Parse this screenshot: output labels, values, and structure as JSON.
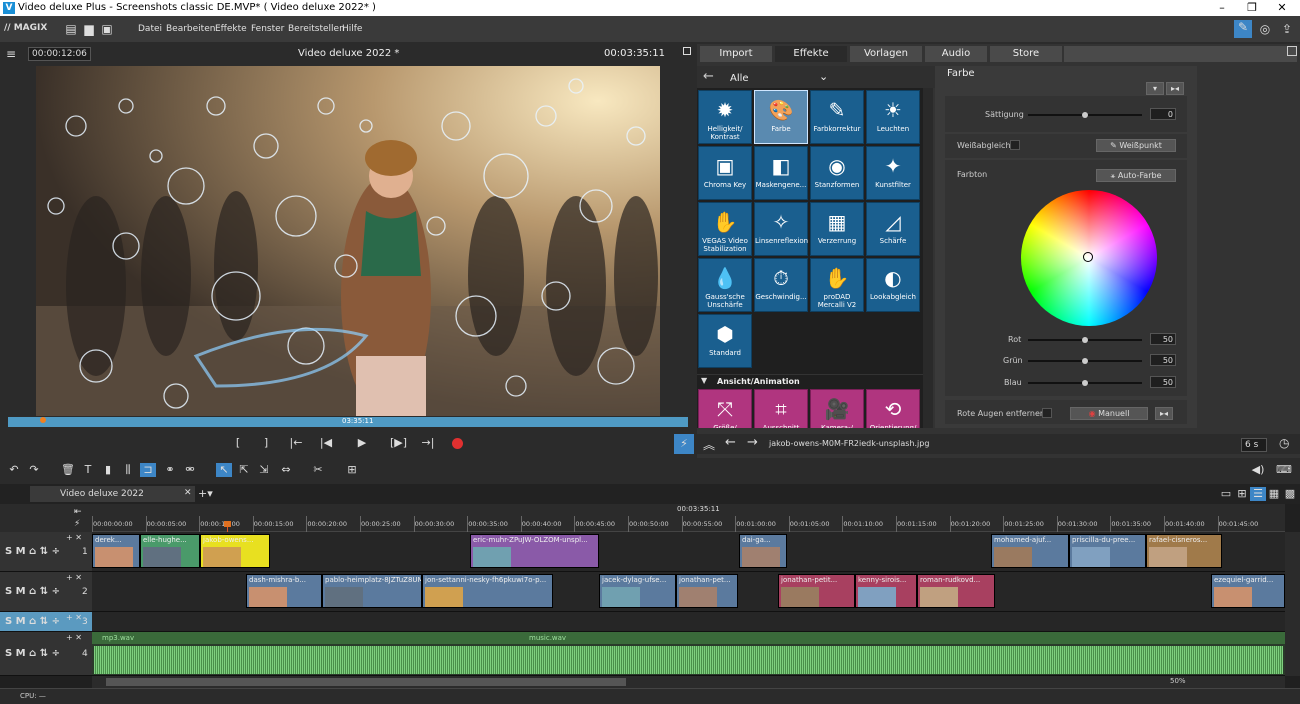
{
  "window": {
    "title": "Video deluxe Plus - Screenshots classic DE.MVP* ( Video deluxe 2022* )",
    "icon_letter": "V"
  },
  "menubar": {
    "brand": "// MAGIX",
    "items": [
      "Datei",
      "Bearbeiten",
      "Effekte",
      "Fenster",
      "Bereitstellen",
      "Hilfe"
    ]
  },
  "preview": {
    "timecode_left": "00:00:12:06",
    "title": "Video deluxe 2022 *",
    "timecode_right": "00:03:35:11",
    "scrub_time": "03:35:11"
  },
  "tabs": [
    "Import",
    "Effekte",
    "Vorlagen",
    "Audio",
    "Store"
  ],
  "active_tab": "Effekte",
  "effects": {
    "filter": "Alle",
    "items": [
      {
        "label": "Helligkeit/ Kontrast",
        "icon": "sun-icon"
      },
      {
        "label": "Farbe",
        "icon": "palette-icon"
      },
      {
        "label": "Farbkorrektur",
        "icon": "palette-brush-icon"
      },
      {
        "label": "Leuchten",
        "icon": "glow-icon"
      },
      {
        "label": "Chroma Key",
        "icon": "chroma-icon"
      },
      {
        "label": "Maskengene...",
        "icon": "mask-icon"
      },
      {
        "label": "Stanzformen",
        "icon": "shape-icon"
      },
      {
        "label": "Kunstfilter",
        "icon": "art-icon"
      },
      {
        "label": "VEGAS Video Stabilization",
        "icon": "hand-icon"
      },
      {
        "label": "Linsenreflexion",
        "icon": "lens-icon"
      },
      {
        "label": "Verzerrung",
        "icon": "distort-icon"
      },
      {
        "label": "Schärfe",
        "icon": "sharp-icon"
      },
      {
        "label": "Gauss'sche Unschärfe",
        "icon": "drop-icon"
      },
      {
        "label": "Geschwindig...",
        "icon": "speed-icon"
      },
      {
        "label": "proDAD Mercalli V2",
        "icon": "hand-icon"
      },
      {
        "label": "Lookabgleich",
        "icon": "look-icon"
      },
      {
        "label": "Standard",
        "icon": "hexagon-icon"
      }
    ],
    "section2": "Ansicht/Animation",
    "items2": [
      {
        "label": "Größe/",
        "icon": "resize-icon"
      },
      {
        "label": "Ausschnitt",
        "icon": "crop-icon"
      },
      {
        "label": "Kamera-/",
        "icon": "camera-icon"
      },
      {
        "label": "Orientierung/",
        "icon": "rotate-icon"
      }
    ]
  },
  "color_panel": {
    "title": "Farbe",
    "saturation_label": "Sättigung",
    "saturation_value": "0",
    "saturation_level": 0.5,
    "wb_label": "Weißabgleich",
    "wb_button": "Weißpunkt",
    "hue_label": "Farbton",
    "auto_button": "Auto-Farbe",
    "rgb": [
      {
        "label": "Rot",
        "value": "50",
        "level": 0.5
      },
      {
        "label": "Grün",
        "value": "50",
        "level": 0.5
      },
      {
        "label": "Blau",
        "value": "50",
        "level": 0.5
      }
    ],
    "redeye_label": "Rote Augen entfernen",
    "redeye_button": "Manuell"
  },
  "navbar": {
    "file": "jakob-owens-M0M-FR2iedk-unsplash.jpg",
    "duration": "6 s"
  },
  "timeline": {
    "tab": "Video deluxe 2022",
    "position": "00:03:35:11",
    "ruler": [
      "00:00:00:00",
      "00:00:05:00",
      "00:00:10:00",
      "00:00:15:00",
      "00:00:20:00",
      "00:00:25:00",
      "00:00:30:00",
      "00:00:35:00",
      "00:00:40:00",
      "00:00:45:00",
      "00:00:50:00",
      "00:00:55:00",
      "00:01:00:00",
      "00:01:05:00",
      "00:01:10:00",
      "00:01:15:00",
      "00:01:20:00",
      "00:01:25:00",
      "00:01:30:00",
      "00:01:35:00",
      "00:01:40:00",
      "00:01:45:00"
    ],
    "tracks": [
      {
        "num": "1",
        "clips": [
          {
            "label": "derek...",
            "start": 0,
            "end": 48,
            "color": "#5b7a9e"
          },
          {
            "label": "elle-hughe...",
            "start": 48,
            "end": 108,
            "color": "#4a9a6a"
          },
          {
            "label": "jakob-owens...",
            "start": 108,
            "end": 178,
            "color": "#e8e020"
          },
          {
            "label": "eric-muhr-ZPuJW-OLZOM-unspl...",
            "start": 378,
            "end": 507,
            "color": "#8a5aa8"
          },
          {
            "label": "dai-ga...",
            "start": 647,
            "end": 695,
            "color": "#5b7a9e"
          },
          {
            "label": "mohamed-ajuf...",
            "start": 899,
            "end": 977,
            "color": "#5b7a9e"
          },
          {
            "label": "priscilla-du-pree...",
            "start": 977,
            "end": 1054,
            "color": "#5b7a9e"
          },
          {
            "label": "rafael-cisneros...",
            "start": 1054,
            "end": 1130,
            "color": "#a07a4a"
          }
        ]
      },
      {
        "num": "2",
        "clips": [
          {
            "label": "dash-mishra-b...",
            "start": 154,
            "end": 230,
            "color": "#5b7a9e"
          },
          {
            "label": "pablo-heimplatz-8JZTuZ8UM...",
            "start": 230,
            "end": 330,
            "color": "#5b7a9e"
          },
          {
            "label": "jon-settanni-nesky-fh6pkuwi7o-p...",
            "start": 330,
            "end": 461,
            "color": "#5b7a9e"
          },
          {
            "label": "jacek-dylag-ufse...",
            "start": 507,
            "end": 584,
            "color": "#5b7a9e"
          },
          {
            "label": "jonathan-pet...",
            "start": 584,
            "end": 646,
            "color": "#5b7a9e"
          },
          {
            "label": "jonathan-petit...",
            "start": 686,
            "end": 763,
            "color": "#a84060"
          },
          {
            "label": "kenny-sirois...",
            "start": 763,
            "end": 825,
            "color": "#a84060"
          },
          {
            "label": "roman-rudkovd...",
            "start": 825,
            "end": 903,
            "color": "#a84060"
          },
          {
            "label": "ezequiel-garrid...",
            "start": 1119,
            "end": 1193,
            "color": "#5b7a9e"
          }
        ]
      },
      {
        "num": "3",
        "clips": []
      },
      {
        "num": "4",
        "audio": [
          "mp3.wav",
          "music.wav"
        ]
      }
    ],
    "zoom": "50%"
  },
  "status": {
    "cpu": "CPU: —"
  }
}
